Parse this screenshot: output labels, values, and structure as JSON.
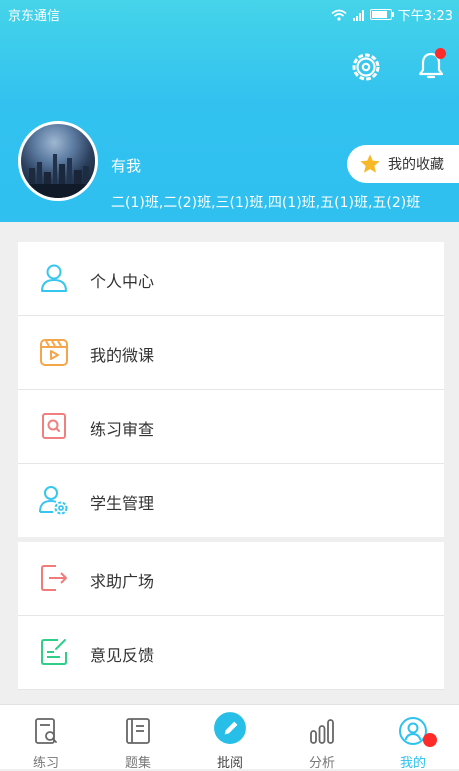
{
  "status_bar": {
    "carrier": "京东通信",
    "time": "下午3:23"
  },
  "profile": {
    "name": "有我",
    "classes": "二(1)班,二(2)班,三(1)班,四(1)班,五(1)班,五(2)班"
  },
  "favorites": {
    "label": "我的收藏"
  },
  "menu_group1": [
    {
      "label": "个人中心",
      "icon": "person-icon"
    },
    {
      "label": "我的微课",
      "icon": "video-clapper-icon"
    },
    {
      "label": "练习审查",
      "icon": "search-document-icon"
    },
    {
      "label": "学生管理",
      "icon": "person-gear-icon"
    }
  ],
  "menu_group2": [
    {
      "label": "求助广场",
      "icon": "exit-arrow-icon"
    },
    {
      "label": "意见反馈",
      "icon": "edit-note-icon"
    }
  ],
  "tabs": [
    {
      "label": "练习",
      "icon": "practice-icon"
    },
    {
      "label": "题集",
      "icon": "book-icon"
    },
    {
      "label": "批阅",
      "icon": "pencil-icon"
    },
    {
      "label": "分析",
      "icon": "analysis-icon"
    },
    {
      "label": "我的",
      "icon": "profile-icon"
    }
  ],
  "colors": {
    "accent": "#2ec2ee",
    "header_top": "#45d4e9",
    "notification": "#ff2a2a"
  }
}
